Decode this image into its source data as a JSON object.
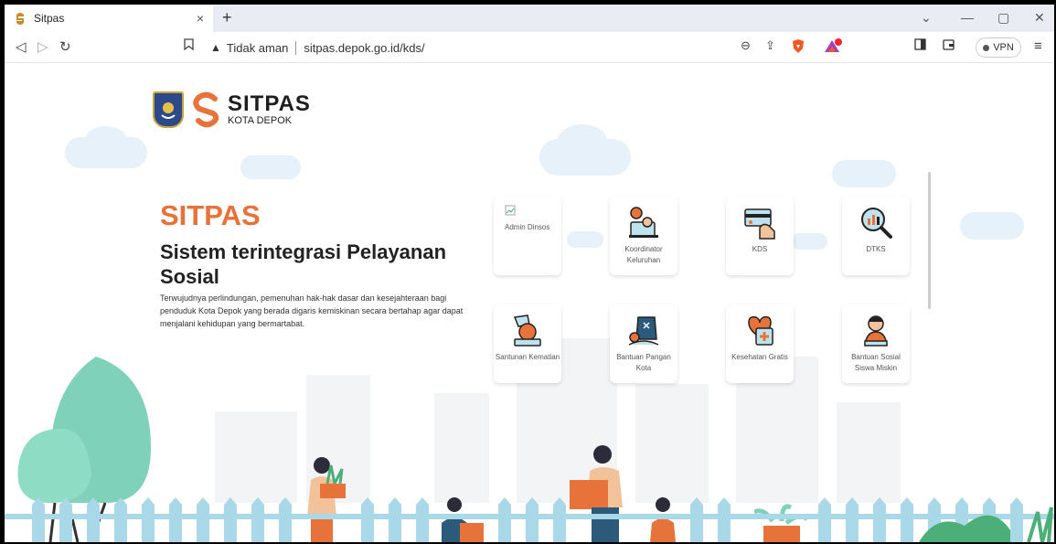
{
  "browser": {
    "tab_title": "Sitpas",
    "tab_close": "×",
    "new_tab": "+",
    "security_warning": "Tidak aman",
    "url": "sitpas.depok.go.id/kds/",
    "vpn_label": "VPN"
  },
  "logo": {
    "name": "SITPAS",
    "subtitle": "KOTA DEPOK"
  },
  "hero": {
    "title": "SITPAS",
    "subtitle": "Sistem terintegrasi Pelayanan Sosial",
    "description": "Terwujudnya perlindungan, pemenuhan hak-hak dasar dan kesejahteraan bagi penduduk Kota Depok yang berada digaris kemiskinan secara bertahap agar dapat menjalani kehidupan yang bermartabat."
  },
  "menu": [
    {
      "label": "Admin Dinsos",
      "icon": "broken-image-icon"
    },
    {
      "label": "Koordinator Keluruhan",
      "icon": "coordinator-icon"
    },
    {
      "label": "KDS",
      "icon": "card-hand-icon"
    },
    {
      "label": "DTKS",
      "icon": "data-search-icon"
    },
    {
      "label": "Santunan Kematian",
      "icon": "donation-box-icon"
    },
    {
      "label": "Bantuan Pangan Kota",
      "icon": "food-aid-icon"
    },
    {
      "label": "Kesehatan Gratis",
      "icon": "health-icon"
    },
    {
      "label": "Bantuan Sosial Siswa Miskin",
      "icon": "student-icon"
    }
  ],
  "colors": {
    "accent": "#e8733a",
    "cloud": "#e6f1fa",
    "fence": "#a9d8e8",
    "tree": "#7fd1b9"
  }
}
